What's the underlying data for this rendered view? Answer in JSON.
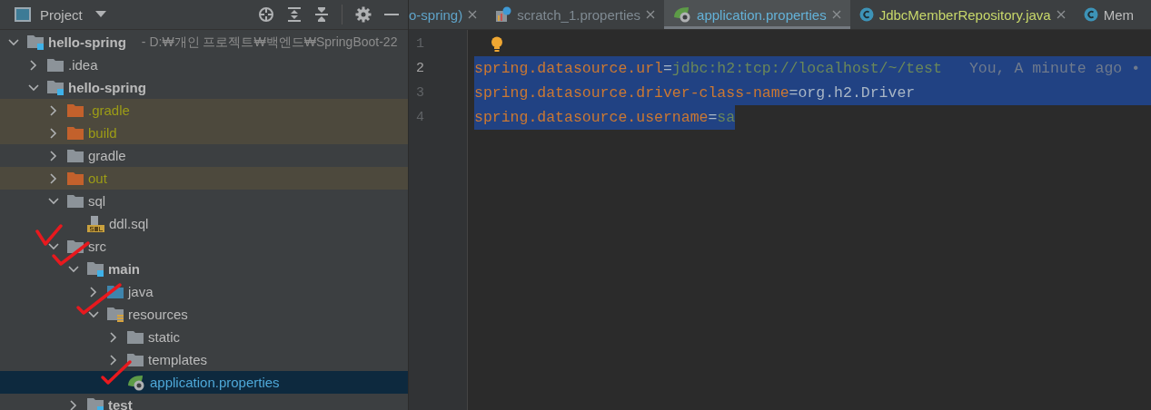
{
  "panel": {
    "title": "Project"
  },
  "tree": [
    {
      "label": "hello-spring",
      "path": "- D:₩개인 프로젝트₩백엔드₩SpringBoot-22",
      "kind": "module",
      "expanded": true,
      "selected": false,
      "children": [
        {
          "label": ".idea",
          "kind": "folder",
          "expanded": false,
          "selected": false
        },
        {
          "label": "hello-spring",
          "kind": "module",
          "expanded": true,
          "selected": false,
          "children": [
            {
              "label": ".gradle",
              "kind": "excluded",
              "expanded": false,
              "selected": false
            },
            {
              "label": "build",
              "kind": "excluded",
              "expanded": false,
              "selected": false
            },
            {
              "label": "gradle",
              "kind": "folder",
              "expanded": false,
              "selected": false
            },
            {
              "label": "out",
              "kind": "excluded",
              "expanded": false,
              "selected": false
            },
            {
              "label": "sql",
              "kind": "folder",
              "expanded": true,
              "selected": false,
              "children": [
                {
                  "label": "ddl.sql",
                  "kind": "sql",
                  "selected": false
                }
              ]
            },
            {
              "label": "src",
              "kind": "folder",
              "expanded": true,
              "selected": false,
              "children": [
                {
                  "label": "main",
                  "kind": "module",
                  "expanded": true,
                  "selected": false,
                  "children": [
                    {
                      "label": "java",
                      "kind": "source",
                      "expanded": false,
                      "selected": false
                    },
                    {
                      "label": "resources",
                      "kind": "resources",
                      "expanded": true,
                      "selected": false,
                      "children": [
                        {
                          "label": "static",
                          "kind": "folder",
                          "expanded": false,
                          "selected": false
                        },
                        {
                          "label": "templates",
                          "kind": "folder",
                          "expanded": false,
                          "selected": false
                        },
                        {
                          "label": "application.properties",
                          "kind": "properties",
                          "selected": true
                        }
                      ]
                    }
                  ]
                },
                {
                  "label": "test",
                  "kind": "module",
                  "expanded": false,
                  "selected": false
                }
              ]
            }
          ]
        }
      ]
    }
  ],
  "tabs": [
    {
      "label": "o-spring)",
      "kind": "none",
      "selected": false
    },
    {
      "label": "scratch_1.properties",
      "kind": "scratch",
      "selected": false
    },
    {
      "label": "application.properties",
      "kind": "properties",
      "selected": true
    },
    {
      "label": "JdbcMemberRepository.java",
      "kind": "class",
      "selected": false
    },
    {
      "label": "Mem",
      "kind": "class",
      "selected": false
    }
  ],
  "lines": [
    {
      "number": "1",
      "current": false,
      "bulb": true
    },
    {
      "number": "2",
      "current": true,
      "selected": true,
      "annotation": "You, A minute ago •",
      "segments": [
        {
          "kind": "key",
          "text": "spring.datasource.url"
        },
        {
          "kind": "sep",
          "text": "="
        },
        {
          "kind": "value",
          "text": "jdbc:h2:tcp://localhost/~/test"
        }
      ]
    },
    {
      "number": "3",
      "current": false,
      "selected": true,
      "segments": [
        {
          "kind": "key",
          "text": "spring.datasource.driver-class-name"
        },
        {
          "kind": "sep",
          "text": "="
        },
        {
          "kind": "plain",
          "text": "org.h2.Driver"
        }
      ]
    },
    {
      "number": "4",
      "current": false,
      "selected": true,
      "segments": [
        {
          "kind": "key",
          "text": "spring.datasource.username"
        },
        {
          "kind": "sep",
          "text": "="
        },
        {
          "kind": "value",
          "text": "sa"
        }
      ]
    }
  ]
}
